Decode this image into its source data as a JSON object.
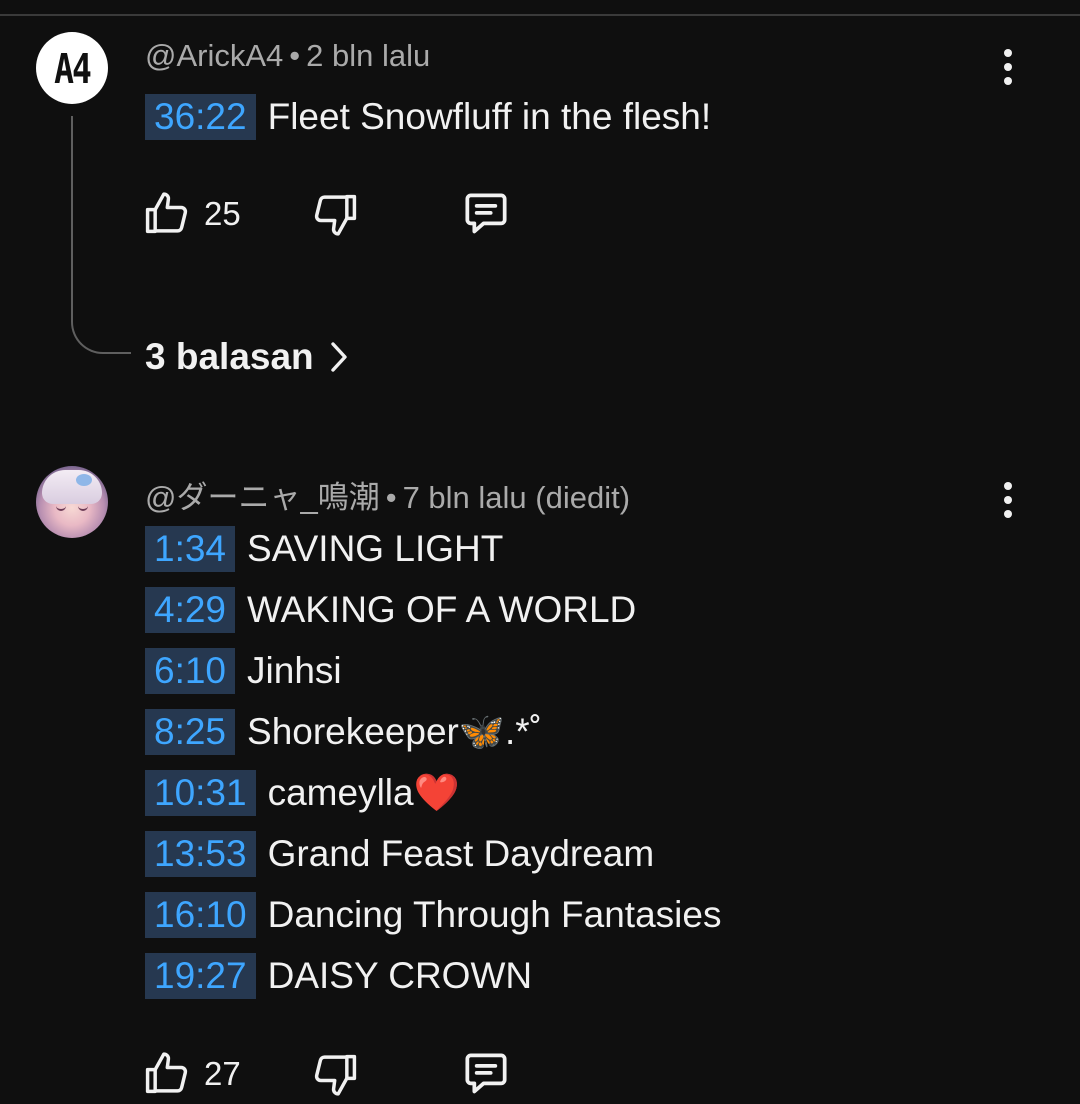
{
  "comments": [
    {
      "avatar_text": "A4",
      "username": "@ArickA4",
      "separator": "•",
      "time": "2 bln lalu",
      "lines": [
        {
          "timestamp": "36:22",
          "text": "Fleet Snowfluff in the flesh!"
        }
      ],
      "like_count": "25",
      "replies_label": "3 balasan",
      "icons": {
        "like": "thumbs-up-icon",
        "dislike": "thumbs-down-icon",
        "reply": "reply-comment-icon",
        "menu": "more-vert-icon",
        "replies": "chevron-right-icon"
      }
    },
    {
      "username": "@ダーニャ_鳴潮",
      "separator": "•",
      "time": "7 bln lalu (diedit)",
      "lines": [
        {
          "timestamp": "1:34",
          "text": "SAVING LIGHT"
        },
        {
          "timestamp": "4:29",
          "text": "WAKING OF A WORLD"
        },
        {
          "timestamp": "6:10",
          "text": "Jinhsi"
        },
        {
          "timestamp": "8:25",
          "text": "Shorekeeper🦋.*˚"
        },
        {
          "timestamp": "10:31",
          "text": "cameylla❤️"
        },
        {
          "timestamp": "13:53",
          "text": "Grand Feast Daydream"
        },
        {
          "timestamp": "16:10",
          "text": "Dancing Through Fantasies"
        },
        {
          "timestamp": "19:27",
          "text": "DAISY CROWN"
        }
      ],
      "like_count": "27",
      "icons": {
        "like": "thumbs-up-icon",
        "dislike": "thumbs-down-icon",
        "reply": "reply-comment-icon",
        "menu": "more-vert-icon"
      }
    }
  ],
  "colors": {
    "background": "#0f0f0f",
    "text": "#f1f1f1",
    "meta": "#aaaaaa",
    "timestamp_text": "#3ea6ff",
    "timestamp_bg": "#263850"
  }
}
